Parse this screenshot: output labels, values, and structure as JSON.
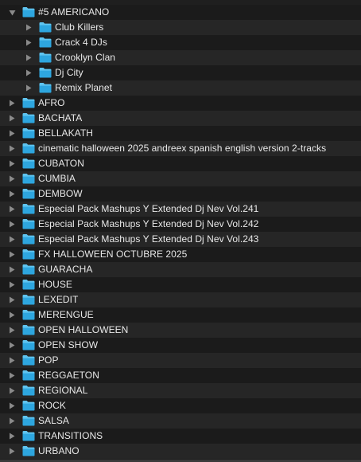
{
  "folders": [
    {
      "label": "#5 AMERICANO",
      "expanded": true,
      "children": [
        {
          "label": "Club Killers"
        },
        {
          "label": "Crack 4 DJs"
        },
        {
          "label": "Crooklyn Clan"
        },
        {
          "label": "Dj City"
        },
        {
          "label": "Remix Planet"
        }
      ]
    },
    {
      "label": "AFRO"
    },
    {
      "label": "BACHATA"
    },
    {
      "label": "BELLAKATH"
    },
    {
      "label": "cinematic halloween 2025 andreex spanish english version 2-tracks"
    },
    {
      "label": "CUBATON"
    },
    {
      "label": "CUMBIA"
    },
    {
      "label": "DEMBOW"
    },
    {
      "label": "Especial Pack Mashups Y Extended Dj Nev Vol.241"
    },
    {
      "label": "Especial Pack Mashups Y Extended Dj Nev Vol.242"
    },
    {
      "label": "Especial Pack Mashups Y Extended Dj Nev Vol.243"
    },
    {
      "label": "FX HALLOWEEN OCTUBRE 2025"
    },
    {
      "label": "GUARACHA"
    },
    {
      "label": "HOUSE"
    },
    {
      "label": "LEXEDIT"
    },
    {
      "label": "MERENGUE"
    },
    {
      "label": "OPEN HALLOWEEN"
    },
    {
      "label": "OPEN SHOW"
    },
    {
      "label": "POP"
    },
    {
      "label": "REGGAETON"
    },
    {
      "label": "REGIONAL"
    },
    {
      "label": "ROCK"
    },
    {
      "label": "SALSA"
    },
    {
      "label": "TRANSITIONS"
    },
    {
      "label": "URBANO"
    }
  ],
  "colors": {
    "folder_fill": "#2ea6df",
    "folder_tab": "#5fc4ef",
    "disclosure": "#8a8a8a",
    "text": "#e8e8e8"
  },
  "icons": {
    "expanded": "disclosure-triangle-down-icon",
    "collapsed": "disclosure-triangle-right-icon",
    "folder": "folder-icon"
  }
}
